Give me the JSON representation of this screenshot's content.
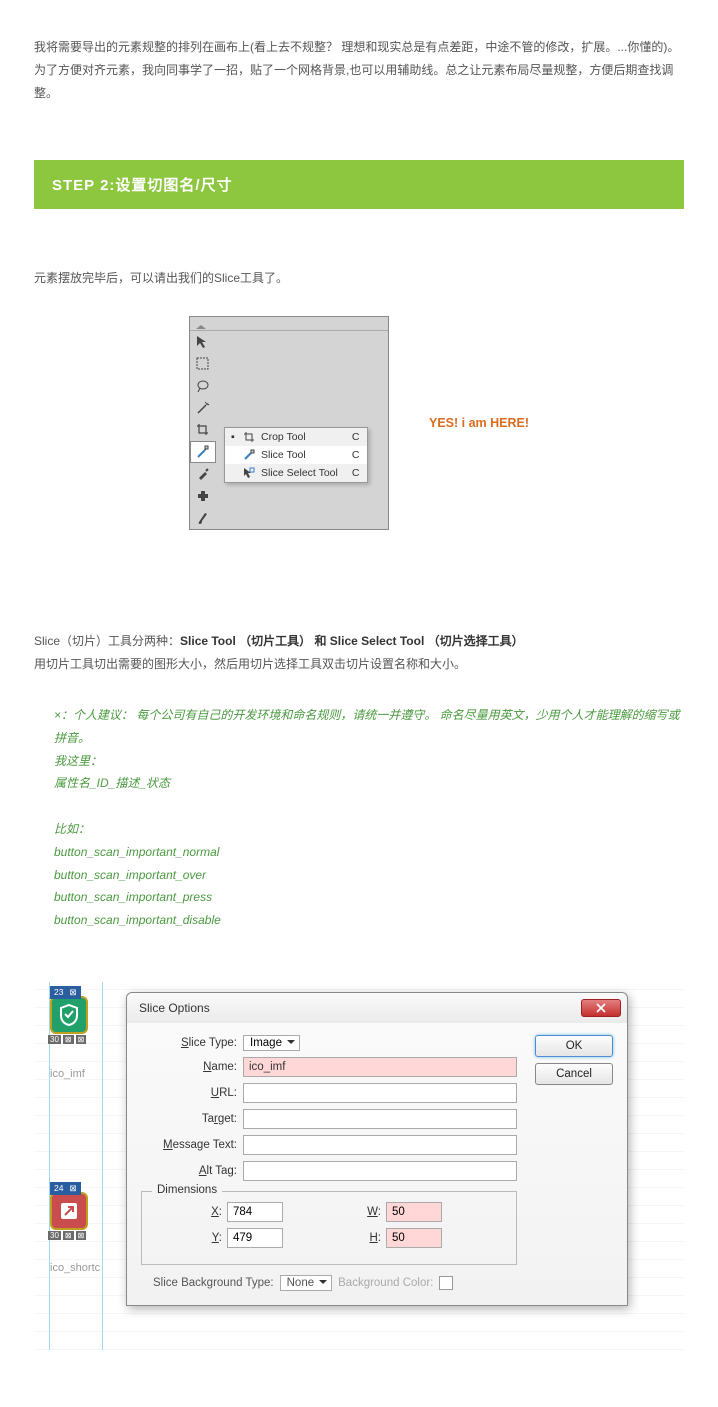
{
  "intro": "我将需要导出的元素规整的排列在画布上(看上去不规整？ 理想和现实总是有点差距，中途不管的修改，扩展。...你懂的)。为了方便对齐元素，我向同事学了一招，贴了一个网格背景,也可以用辅助线。总之让元素布局尽量规整，方便后期查找调整。",
  "step_banner": "STEP 2:设置切图名/尺寸",
  "after_layout": "元素摆放完毕后，可以请出我们的Slice工具了。",
  "flyout": {
    "items": [
      {
        "label": "Crop Tool",
        "key": "C"
      },
      {
        "label": "Slice Tool",
        "key": "C"
      },
      {
        "label": "Slice Select Tool",
        "key": "C"
      }
    ]
  },
  "yes_text": "YES! i am HERE!",
  "def_line1_a": "Slice（切片）工具分两种：",
  "def_line1_b": "Slice Tool （切片工具） 和  Slice Select Tool （切片选择工具）",
  "def_line2": "用切片工具切出需要的图形大小，然后用切片选择工具双击切片设置名称和大小。",
  "tip": {
    "l1": "×：个人建议： 每个公司有自己的开发环境和命名规则，请统一并遵守。 命名尽量用英文，少用个人才能理解的缩写或拼音。",
    "l2": "我这里：",
    "l3": "属性名_ID_描述_状态",
    "l4": "比如：",
    "l5": "button_scan_important_normal",
    "l6": "button_scan_important_over",
    "l7": "button_scan_important_press",
    "l8": "button_scan_important_disable"
  },
  "dialog": {
    "title": "Slice Options",
    "slice_type_label": "Slice Type:",
    "slice_type_value": "Image",
    "name_label": "Name:",
    "name_value": "ico_imf",
    "url_label": "URL:",
    "target_label": "Target:",
    "msg_label": "Message Text:",
    "alt_label": "Alt Tag:",
    "ok": "OK",
    "cancel": "Cancel",
    "dimensions": "Dimensions",
    "x_label": "X:",
    "x_val": "784",
    "y_label": "Y:",
    "y_val": "479",
    "w_label": "W:",
    "w_val": "50",
    "h_label": "H:",
    "h_val": "50",
    "bg_type_label": "Slice Background Type:",
    "bg_type_value": "None",
    "bg_color_label": "Background Color:"
  },
  "ico_label_1": "ico_imf",
  "ico_label_2": "ico_shortc",
  "slice_badge_1a": "23",
  "slice_badge_1b": "⊠",
  "slice_badge_2a": "24",
  "slice_badge_2b": "⊠",
  "slice_btm_a": "30",
  "slice_btm_b": "⊠",
  "slice_btm_c": "⊠"
}
